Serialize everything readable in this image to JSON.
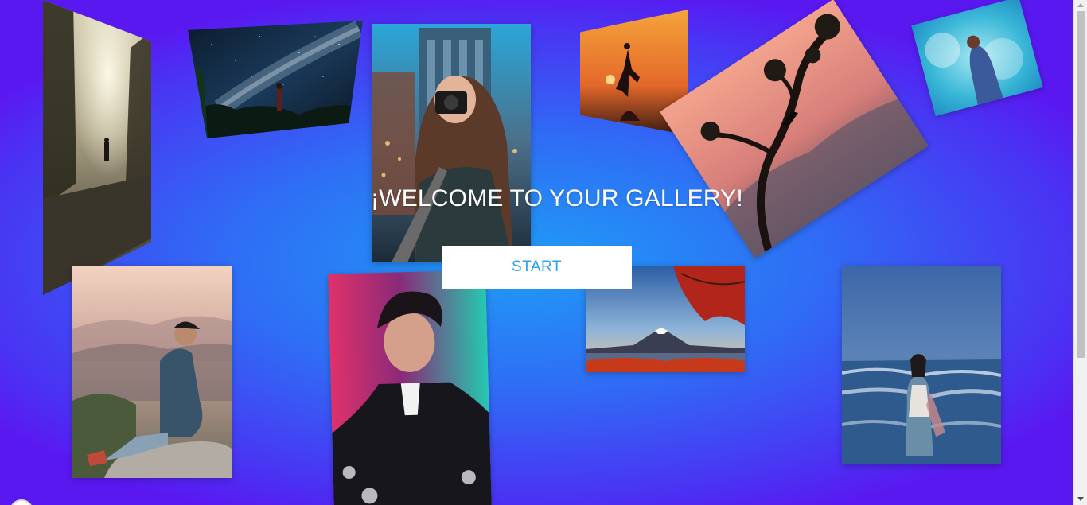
{
  "hero": {
    "title": "¡WELCOME TO YOUR GALLERY!",
    "start_label": "START"
  },
  "gallery": {
    "photos": [
      {
        "name": "photo-forest-path",
        "subject": "person on forest path in fog"
      },
      {
        "name": "photo-milky-way",
        "subject": "person under milky way night sky"
      },
      {
        "name": "photo-city-camera",
        "subject": "woman holding camera in city"
      },
      {
        "name": "photo-sunset-silhouette",
        "subject": "silhouette jumping at sunset"
      },
      {
        "name": "photo-tree-cliff",
        "subject": "person on tree branch over city at dusk"
      },
      {
        "name": "photo-color-smoke",
        "subject": "woman in blue smoke"
      },
      {
        "name": "photo-mountain-sitting",
        "subject": "man sitting on rock in mountains"
      },
      {
        "name": "photo-neon-portrait",
        "subject": "young man portrait with pink and teal lighting"
      },
      {
        "name": "photo-mount-fuji",
        "subject": "mountain with red maple leaves"
      },
      {
        "name": "photo-beach-woman",
        "subject": "woman walking in ocean waves"
      }
    ]
  },
  "colors": {
    "background_center": "#1f9cf6",
    "background_edge": "#5a18f1",
    "button_bg": "#ffffff",
    "button_text": "#29a3f2",
    "title_text": "#ffffff"
  }
}
